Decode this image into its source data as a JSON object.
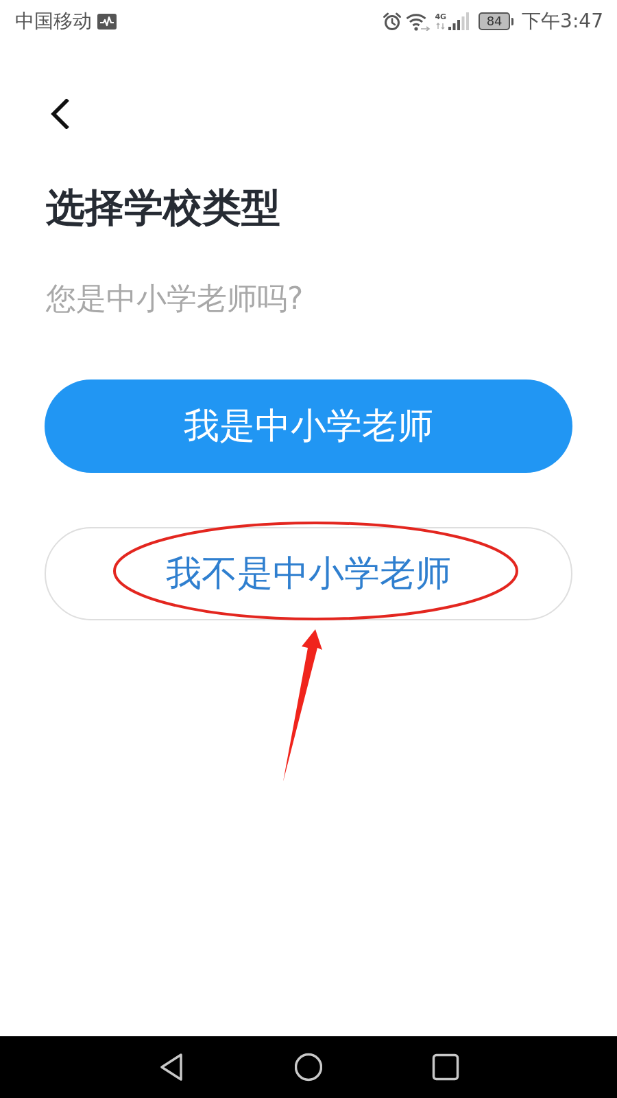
{
  "status_bar": {
    "carrier": "中国移动",
    "network": "4G",
    "battery": "84",
    "time": "下午3:47"
  },
  "title": "选择学校类型",
  "subtitle": "您是中小学老师吗?",
  "buttons": [
    {
      "label": "我是中小学老师",
      "kind": "primary",
      "highlighted": false
    },
    {
      "label": "我不是中小学老师",
      "kind": "secondary",
      "highlighted": true
    }
  ]
}
